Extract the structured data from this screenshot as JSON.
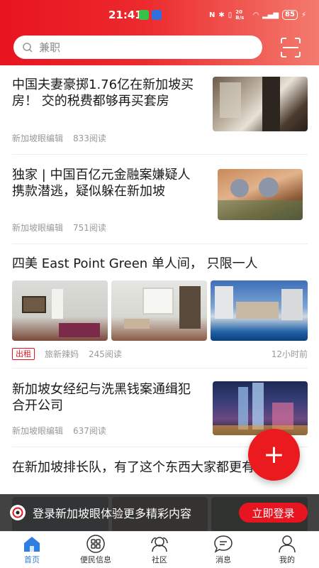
{
  "status_bar": {
    "time": "21:41",
    "battery": "85",
    "net_speed": "20 B/s"
  },
  "search": {
    "placeholder": "兼职"
  },
  "articles": [
    {
      "title": "中国夫妻豪掷1.76亿在新加坡买房！ 交的税费都够再买套房",
      "author": "新加坡眼编辑",
      "reads": "833阅读"
    },
    {
      "title": "独家 | 中国百亿元金融案嫌疑人携款潜逃，疑似躲在新加坡",
      "author": "新加坡眼编辑",
      "reads": "751阅读"
    },
    {
      "title": "四美 East Point Green 单人间， 只限一人",
      "tag": "出租",
      "author": "旅新辣妈",
      "reads": "245阅读",
      "time": "12小时前"
    },
    {
      "title": "新加坡女经纪与洗黑钱案通缉犯合开公司",
      "author": "新加坡眼编辑",
      "reads": "637阅读"
    },
    {
      "title": "在新加坡排长队，有了这个东西大家都更有耐心"
    }
  ],
  "fab": {
    "label": "+"
  },
  "login_banner": {
    "text": "登录新加坡眼体验更多精彩内容",
    "button": "立即登录"
  },
  "nav": [
    {
      "label": "首页",
      "icon": "home-icon"
    },
    {
      "label": "便民信息",
      "icon": "grid-icon"
    },
    {
      "label": "社区",
      "icon": "community-icon"
    },
    {
      "label": "消息",
      "icon": "message-icon"
    },
    {
      "label": "我的",
      "icon": "profile-icon"
    }
  ],
  "colors": {
    "brand_red": "#e8141f",
    "nav_active": "#2f7fe0"
  }
}
